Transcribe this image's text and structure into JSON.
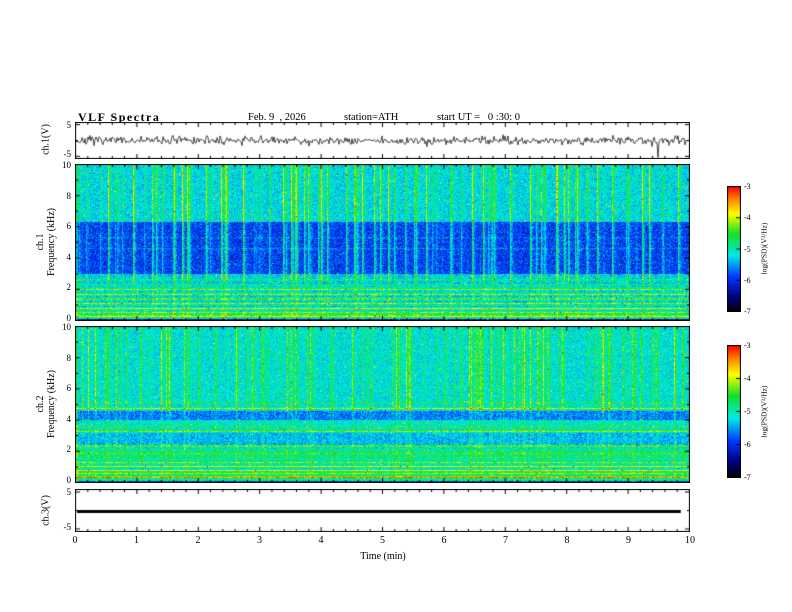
{
  "header": {
    "title": "VLF Spectra",
    "date": "Feb. 9  , 2026",
    "station": "station=ATH",
    "start_ut": "start UT =   0 :30: 0"
  },
  "x_axis": {
    "label": "Time  (min)",
    "ticks": [
      "0",
      "1",
      "2",
      "3",
      "4",
      "5",
      "6",
      "7",
      "8",
      "9",
      "10"
    ],
    "range_min": [
      0,
      10
    ]
  },
  "panels": {
    "wave1": {
      "ylabel": "ch.1(V)",
      "yticks": [
        "5",
        "-5"
      ],
      "ylim_volts": [
        -5,
        5
      ]
    },
    "spec1": {
      "ylabel_line1": "ch.1",
      "ylabel_line2": "Frequency (kHz)",
      "yticks": [
        "10",
        "8",
        "6",
        "4",
        "2",
        "0"
      ],
      "ylim_khz": [
        0,
        10
      ]
    },
    "spec2": {
      "ylabel_line1": "ch.2",
      "ylabel_line2": "Frequency (kHz)",
      "yticks": [
        "10",
        "8",
        "6",
        "4",
        "2",
        "0"
      ],
      "ylim_khz": [
        0,
        10
      ]
    },
    "wave3": {
      "ylabel": "ch.3(V)",
      "yticks": [
        "5",
        "-5"
      ],
      "ylim_volts": [
        -5,
        5
      ]
    }
  },
  "colorbars": {
    "label": "log(PSD)(V²/Hz)",
    "ticks": [
      "-3",
      "-4",
      "-5",
      "-6",
      "-7"
    ],
    "range": [
      -7,
      -3
    ]
  },
  "chart_data": [
    {
      "panel": "ch1_waveform",
      "type": "line",
      "xlim": [
        0,
        10
      ],
      "ylabel": "ch.1(V)",
      "ylim": [
        -5,
        5
      ],
      "summary": "continuous broadband VLF noise, ~±1.5 V envelope with intermittent sferic spikes to ~±3 V",
      "line_color": "#000000",
      "render": {
        "seed": 7,
        "sigma_v": 0.6,
        "spike_prob": 0.006,
        "spike_gain": 3.2
      }
    },
    {
      "panel": "ch1_spectrogram",
      "type": "heatmap",
      "xlim": [
        0,
        10
      ],
      "ylabel": "ch.1 Frequency (kHz)",
      "ylim": [
        0,
        10
      ],
      "value_axis": "log(PSD)(V²/Hz)",
      "value_range": [
        -7,
        -3
      ],
      "colormap": "black-blue-cyan-green-yellow-red",
      "summary": "dense vertical sferic bursts over full band; quiet blue band 3-6.3 kHz; banded hum/harmonic lines below ~2.6 kHz; diffuse cyan-green above 6.3 kHz; dark strip at 0 kHz",
      "render": {
        "seed": 11,
        "bands": [
          [
            0,
            0.15,
            0.13
          ],
          [
            0.15,
            0.6,
            0.54
          ],
          [
            0.6,
            2.3,
            0.47
          ],
          [
            2.3,
            3.0,
            0.42
          ],
          [
            3.0,
            6.3,
            0.27
          ],
          [
            6.3,
            10,
            0.44
          ]
        ],
        "lines": [
          [
            0.3,
            0.3
          ],
          [
            0.55,
            0.22
          ],
          [
            0.8,
            0.26
          ],
          [
            1.1,
            0.22
          ],
          [
            1.4,
            0.2
          ],
          [
            1.7,
            0.22
          ],
          [
            2.0,
            0.2
          ],
          [
            2.3,
            0.18
          ],
          [
            2.6,
            0.2
          ],
          [
            4.6,
            0.08
          ],
          [
            5.3,
            0.06
          ]
        ],
        "line_halfwidth_khz": 0.07,
        "stripe_below_khz": 2.3,
        "stripe_amp": 0.06,
        "burst_threshold": 0.78,
        "burst_gain_low": 0.12,
        "burst_gain_high": 0.36,
        "burst_split_khz": 2.6,
        "noise": 0.17,
        "speckle_prob": 0.012,
        "speckle_amp": 0.3
      }
    },
    {
      "panel": "ch2_spectrogram",
      "type": "heatmap",
      "xlim": [
        0,
        10
      ],
      "ylabel": "ch.2 Frequency (kHz)",
      "ylim": [
        0,
        10
      ],
      "value_axis": "log(PSD)(V²/Hz)",
      "value_range": [
        -7,
        -3
      ],
      "colormap": "black-blue-cyan-green-yellow-red",
      "summary": "green-cyan background; strong horizontal interference lines below ~5 kHz (bright yellow near 0.35, 0.8, 1.9, 3.3, 4.75 kHz); darker blue band 4.0-4.6 kHz; vertical sferic bursts mainly above 4.6 kHz",
      "render": {
        "seed": 23,
        "bands": [
          [
            0,
            0.15,
            0.2
          ],
          [
            0.15,
            0.7,
            0.56
          ],
          [
            0.7,
            2.4,
            0.5
          ],
          [
            2.4,
            3.2,
            0.4
          ],
          [
            3.2,
            4.0,
            0.47
          ],
          [
            4.0,
            4.6,
            0.34
          ],
          [
            4.6,
            10,
            0.46
          ]
        ],
        "lines": [
          [
            0.35,
            0.3
          ],
          [
            0.6,
            0.2
          ],
          [
            0.8,
            0.24
          ],
          [
            1.05,
            0.2
          ],
          [
            1.3,
            0.22
          ],
          [
            1.6,
            0.18
          ],
          [
            1.9,
            0.26
          ],
          [
            2.35,
            0.18
          ],
          [
            3.3,
            0.3
          ],
          [
            3.6,
            0.14
          ],
          [
            4.75,
            0.28
          ],
          [
            5.1,
            0.12
          ]
        ],
        "line_halfwidth_khz": 0.07,
        "stripe_below_khz": 2.4,
        "stripe_amp": 0.06,
        "burst_threshold": 0.8,
        "burst_gain_low": 0.1,
        "burst_gain_high": 0.3,
        "burst_split_khz": 4.6,
        "noise": 0.17,
        "speckle_prob": 0.01,
        "speckle_amp": 0.28
      }
    },
    {
      "panel": "ch3_waveform",
      "type": "line",
      "xlim": [
        0,
        10
      ],
      "ylabel": "ch.3(V)",
      "ylim": [
        -5,
        5
      ],
      "summary": "flat thick line at 0 V (no signal on channel 3)",
      "line_color": "#000000",
      "render": {
        "value": 0,
        "line_width": 3
      }
    }
  ]
}
